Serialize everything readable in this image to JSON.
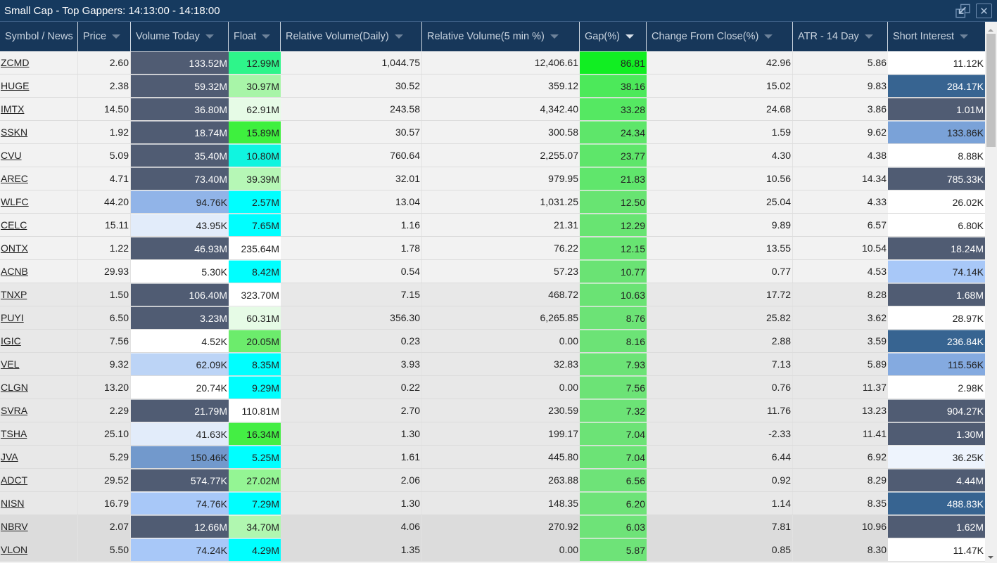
{
  "window": {
    "title": "Small Cap - Top Gappers: 14:13:00 - 14:18:00",
    "restore_icon": "restore-window-icon",
    "close_icon": "close-icon"
  },
  "columns": [
    {
      "label": "Symbol / News",
      "sortable": false
    },
    {
      "label": "Price",
      "sortable": true
    },
    {
      "label": "Volume Today",
      "sortable": true
    },
    {
      "label": "Float",
      "sortable": true
    },
    {
      "label": "Relative Volume(Daily)",
      "sortable": true
    },
    {
      "label": "Relative Volume(5 min %)",
      "sortable": true
    },
    {
      "label": "Gap(%)",
      "sortable": true,
      "active_sort": "descending"
    },
    {
      "label": "Change From Close(%)",
      "sortable": true
    },
    {
      "label": "ATR - 14 Day",
      "sortable": true
    },
    {
      "label": "Short Interest",
      "sortable": true
    }
  ],
  "colors": {
    "title_bg": "#163a5f",
    "header_bg": "#17375a",
    "vol_dark": "#505c73",
    "vol_mid": "#7299cc",
    "vol_light": "#91b4e8",
    "vol_pale": "#bcd4f6",
    "vol_faint": "#e2ecfa",
    "float_cyan": "#00ffff",
    "gap_bright": "#11ee22"
  },
  "rows": [
    {
      "symbol": "ZCMD",
      "price": "2.60",
      "volume": "133.52M",
      "volume_bg": "#505c73",
      "volume_dark": true,
      "float": "12.99M",
      "float_bg": "#2ef58a",
      "rel_daily": "1,044.75",
      "rel_5min": "12,406.61",
      "gap": "86.81",
      "gap_bg": "#11ee22",
      "chg": "42.96",
      "atr": "5.86",
      "short": "11.12K",
      "short_bg": "#ffffff",
      "short_dark": false,
      "group": "g1"
    },
    {
      "symbol": "HUGE",
      "price": "2.38",
      "volume": "59.32M",
      "volume_bg": "#505c73",
      "volume_dark": true,
      "float": "30.97M",
      "float_bg": "#a8f5a8",
      "rel_daily": "30.52",
      "rel_5min": "359.12",
      "gap": "38.16",
      "gap_bg": "#4ce95a",
      "chg": "15.02",
      "atr": "9.83",
      "short": "284.17K",
      "short_bg": "#376491",
      "short_dark": true,
      "group": "g1"
    },
    {
      "symbol": "IMTX",
      "price": "14.50",
      "volume": "36.80M",
      "volume_bg": "#505c73",
      "volume_dark": true,
      "float": "62.91M",
      "float_bg": "#e6fbe6",
      "rel_daily": "243.58",
      "rel_5min": "4,342.40",
      "gap": "33.28",
      "gap_bg": "#55e862",
      "chg": "24.68",
      "atr": "3.86",
      "short": "1.01M",
      "short_bg": "#505c73",
      "short_dark": true,
      "group": "g1"
    },
    {
      "symbol": "SSKN",
      "price": "1.92",
      "volume": "18.74M",
      "volume_bg": "#505c73",
      "volume_dark": true,
      "float": "15.89M",
      "float_bg": "#3ef03e",
      "rel_daily": "30.57",
      "rel_5min": "300.58",
      "gap": "24.34",
      "gap_bg": "#5ee66a",
      "chg": "1.59",
      "atr": "9.62",
      "short": "133.86K",
      "short_bg": "#7aa2d8",
      "short_dark": false,
      "group": "g1"
    },
    {
      "symbol": "CVU",
      "price": "5.09",
      "volume": "35.40M",
      "volume_bg": "#505c73",
      "volume_dark": true,
      "float": "10.80M",
      "float_bg": "#10f5e0",
      "rel_daily": "760.64",
      "rel_5min": "2,255.07",
      "gap": "23.77",
      "gap_bg": "#5ee66a",
      "chg": "4.30",
      "atr": "4.38",
      "short": "8.88K",
      "short_bg": "#ffffff",
      "short_dark": false,
      "group": "g1"
    },
    {
      "symbol": "AREC",
      "price": "4.71",
      "volume": "73.40M",
      "volume_bg": "#505c73",
      "volume_dark": true,
      "float": "39.39M",
      "float_bg": "#b6f7b6",
      "rel_daily": "32.01",
      "rel_5min": "979.95",
      "gap": "21.83",
      "gap_bg": "#60e66c",
      "chg": "10.56",
      "atr": "14.34",
      "short": "785.33K",
      "short_bg": "#505c73",
      "short_dark": true,
      "group": "g1"
    },
    {
      "symbol": "WLFC",
      "price": "44.20",
      "volume": "94.76K",
      "volume_bg": "#91b4e8",
      "volume_dark": false,
      "float": "2.57M",
      "float_bg": "#00ffff",
      "rel_daily": "13.04",
      "rel_5min": "1,031.25",
      "gap": "12.50",
      "gap_bg": "#68e472",
      "chg": "25.04",
      "atr": "4.33",
      "short": "26.02K",
      "short_bg": "#ffffff",
      "short_dark": false,
      "group": "g1"
    },
    {
      "symbol": "CELC",
      "price": "15.11",
      "volume": "43.95K",
      "volume_bg": "#e2ecfa",
      "volume_dark": false,
      "float": "7.65M",
      "float_bg": "#00ffff",
      "rel_daily": "1.16",
      "rel_5min": "21.31",
      "gap": "12.29",
      "gap_bg": "#68e472",
      "chg": "9.89",
      "atr": "6.57",
      "short": "6.80K",
      "short_bg": "#ffffff",
      "short_dark": false,
      "group": "g1"
    },
    {
      "symbol": "ONTX",
      "price": "1.22",
      "volume": "46.93M",
      "volume_bg": "#505c73",
      "volume_dark": true,
      "float": "235.64M",
      "float_bg": "#ffffff",
      "rel_daily": "1.78",
      "rel_5min": "76.22",
      "gap": "12.15",
      "gap_bg": "#68e472",
      "chg": "13.55",
      "atr": "10.54",
      "short": "18.24M",
      "short_bg": "#505c73",
      "short_dark": true,
      "group": "g1"
    },
    {
      "symbol": "ACNB",
      "price": "29.93",
      "volume": "5.30K",
      "volume_bg": "#ffffff",
      "volume_dark": false,
      "float": "8.42M",
      "float_bg": "#00ffff",
      "rel_daily": "0.54",
      "rel_5min": "57.23",
      "gap": "10.77",
      "gap_bg": "#6ae374",
      "chg": "0.77",
      "atr": "4.53",
      "short": "74.14K",
      "short_bg": "#a8c8f8",
      "short_dark": false,
      "group": "g1"
    },
    {
      "symbol": "TNXP",
      "price": "1.50",
      "volume": "106.40M",
      "volume_bg": "#505c73",
      "volume_dark": true,
      "float": "323.70M",
      "float_bg": "#ffffff",
      "rel_daily": "7.15",
      "rel_5min": "468.72",
      "gap": "10.63",
      "gap_bg": "#6ae374",
      "chg": "17.72",
      "atr": "8.28",
      "short": "1.68M",
      "short_bg": "#505c73",
      "short_dark": true,
      "group": "g2"
    },
    {
      "symbol": "PUYI",
      "price": "6.50",
      "volume": "3.23M",
      "volume_bg": "#505c73",
      "volume_dark": true,
      "float": "60.31M",
      "float_bg": "#e6fbe6",
      "rel_daily": "356.30",
      "rel_5min": "6,265.85",
      "gap": "8.76",
      "gap_bg": "#6ce376",
      "chg": "25.82",
      "atr": "3.62",
      "short": "28.97K",
      "short_bg": "#ffffff",
      "short_dark": false,
      "group": "g2"
    },
    {
      "symbol": "IGIC",
      "price": "7.56",
      "volume": "4.52K",
      "volume_bg": "#ffffff",
      "volume_dark": false,
      "float": "20.05M",
      "float_bg": "#6cec6c",
      "rel_daily": "0.23",
      "rel_5min": "0.00",
      "gap": "8.16",
      "gap_bg": "#6ce376",
      "chg": "2.88",
      "atr": "3.59",
      "short": "236.84K",
      "short_bg": "#376491",
      "short_dark": true,
      "group": "g2"
    },
    {
      "symbol": "VEL",
      "price": "9.32",
      "volume": "62.09K",
      "volume_bg": "#bcd4f6",
      "volume_dark": false,
      "float": "8.35M",
      "float_bg": "#00ffff",
      "rel_daily": "3.93",
      "rel_5min": "32.83",
      "gap": "7.93",
      "gap_bg": "#6ce376",
      "chg": "7.13",
      "atr": "5.89",
      "short": "115.56K",
      "short_bg": "#84aae0",
      "short_dark": false,
      "group": "g2"
    },
    {
      "symbol": "CLGN",
      "price": "13.20",
      "volume": "20.74K",
      "volume_bg": "#ffffff",
      "volume_dark": false,
      "float": "9.29M",
      "float_bg": "#00ffff",
      "rel_daily": "0.22",
      "rel_5min": "0.00",
      "gap": "7.56",
      "gap_bg": "#6ce376",
      "chg": "0.76",
      "atr": "11.37",
      "short": "2.98K",
      "short_bg": "#ffffff",
      "short_dark": false,
      "group": "g2"
    },
    {
      "symbol": "SVRA",
      "price": "2.29",
      "volume": "21.79M",
      "volume_bg": "#505c73",
      "volume_dark": true,
      "float": "110.81M",
      "float_bg": "#ffffff",
      "rel_daily": "2.70",
      "rel_5min": "230.59",
      "gap": "7.32",
      "gap_bg": "#6ce376",
      "chg": "11.76",
      "atr": "13.23",
      "short": "904.27K",
      "short_bg": "#505c73",
      "short_dark": true,
      "group": "g2"
    },
    {
      "symbol": "TSHA",
      "price": "25.10",
      "volume": "41.63K",
      "volume_bg": "#e2ecfa",
      "volume_dark": false,
      "float": "16.34M",
      "float_bg": "#44ee44",
      "rel_daily": "1.30",
      "rel_5min": "199.17",
      "gap": "7.04",
      "gap_bg": "#6ce376",
      "chg": "-2.33",
      "atr": "11.41",
      "short": "1.30M",
      "short_bg": "#505c73",
      "short_dark": true,
      "group": "g2"
    },
    {
      "symbol": "JVA",
      "price": "5.29",
      "volume": "150.46K",
      "volume_bg": "#7299cc",
      "volume_dark": false,
      "float": "5.25M",
      "float_bg": "#00ffff",
      "rel_daily": "1.61",
      "rel_5min": "445.80",
      "gap": "7.04",
      "gap_bg": "#6ce376",
      "chg": "6.44",
      "atr": "6.92",
      "short": "36.25K",
      "short_bg": "#eef4fd",
      "short_dark": false,
      "group": "g2"
    },
    {
      "symbol": "ADCT",
      "price": "29.52",
      "volume": "574.77K",
      "volume_bg": "#505c73",
      "volume_dark": true,
      "float": "27.02M",
      "float_bg": "#94f594",
      "rel_daily": "2.06",
      "rel_5min": "263.88",
      "gap": "6.56",
      "gap_bg": "#6ee378",
      "chg": "0.92",
      "atr": "8.29",
      "short": "4.44M",
      "short_bg": "#505c73",
      "short_dark": true,
      "group": "g2"
    },
    {
      "symbol": "NISN",
      "price": "16.79",
      "volume": "74.76K",
      "volume_bg": "#a8c8f8",
      "volume_dark": false,
      "float": "7.29M",
      "float_bg": "#00ffff",
      "rel_daily": "1.30",
      "rel_5min": "148.35",
      "gap": "6.20",
      "gap_bg": "#6ee378",
      "chg": "1.14",
      "atr": "8.35",
      "short": "488.83K",
      "short_bg": "#376491",
      "short_dark": true,
      "group": "g2"
    },
    {
      "symbol": "NBRV",
      "price": "2.07",
      "volume": "12.66M",
      "volume_bg": "#505c73",
      "volume_dark": true,
      "float": "34.70M",
      "float_bg": "#b0f7b0",
      "rel_daily": "4.06",
      "rel_5min": "270.92",
      "gap": "6.03",
      "gap_bg": "#6ee378",
      "chg": "7.81",
      "atr": "10.96",
      "short": "1.62M",
      "short_bg": "#505c73",
      "short_dark": true,
      "group": "g3"
    },
    {
      "symbol": "VLON",
      "price": "5.50",
      "volume": "74.24K",
      "volume_bg": "#a8c8f8",
      "volume_dark": false,
      "float": "4.29M",
      "float_bg": "#00ffff",
      "rel_daily": "1.35",
      "rel_5min": "0.00",
      "gap": "5.87",
      "gap_bg": "#6ee378",
      "chg": "0.85",
      "atr": "8.30",
      "short": "11.47K",
      "short_bg": "#ffffff",
      "short_dark": false,
      "group": "g3"
    }
  ]
}
